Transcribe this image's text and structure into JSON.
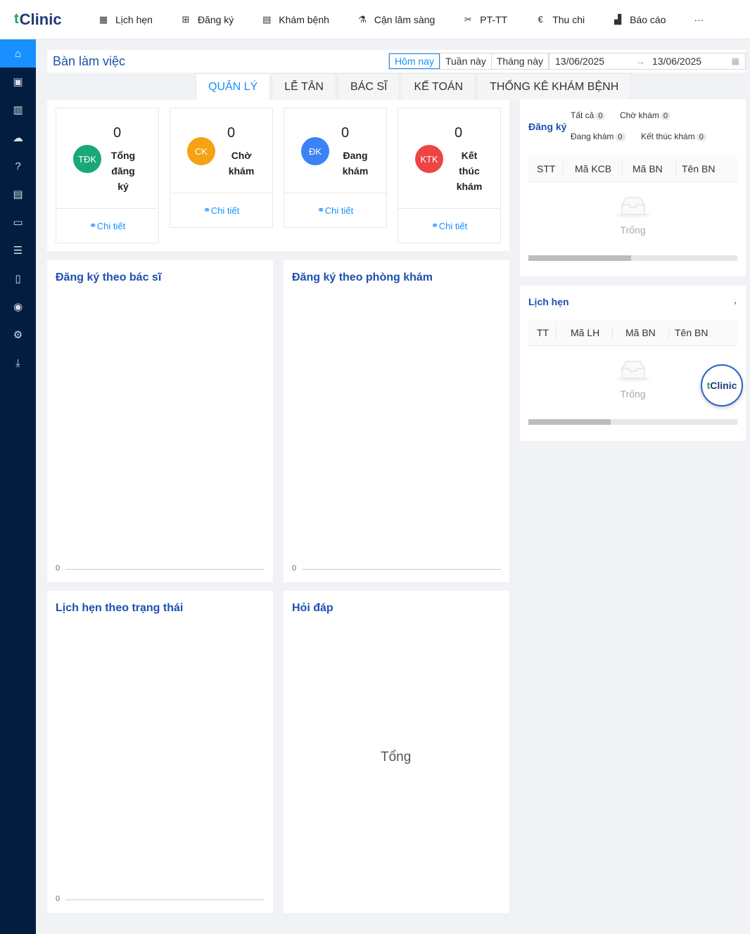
{
  "brand": {
    "name": "Clinic",
    "mark": "t"
  },
  "nav": [
    {
      "label": "Lịch hẹn",
      "icon": "calendar-icon",
      "glyph": "▦"
    },
    {
      "label": "Đăng ký",
      "icon": "plus-square-icon",
      "glyph": "⊞"
    },
    {
      "label": "Khám bệnh",
      "icon": "clipboard-icon",
      "glyph": "▤"
    },
    {
      "label": "Cận lâm sàng",
      "icon": "flask-icon",
      "glyph": "⚗"
    },
    {
      "label": "PT-TT",
      "icon": "scissors-icon",
      "glyph": "✂"
    },
    {
      "label": "Thu chi",
      "icon": "euro-circle-icon",
      "glyph": "€"
    },
    {
      "label": "Báo cáo",
      "icon": "area-chart-icon",
      "glyph": "▟"
    }
  ],
  "nav_more": "···",
  "sidebar": [
    {
      "icon": "home-icon",
      "glyph": "⌂",
      "active": true
    },
    {
      "icon": "id-card-icon",
      "glyph": "▣"
    },
    {
      "icon": "shop-icon",
      "glyph": "▥"
    },
    {
      "icon": "cloud-upload-icon",
      "glyph": "☁"
    },
    {
      "icon": "question-circle-icon",
      "glyph": "?"
    },
    {
      "icon": "profile-icon",
      "glyph": "▤"
    },
    {
      "icon": "money-icon",
      "glyph": "▭"
    },
    {
      "icon": "list-icon",
      "glyph": "☰"
    },
    {
      "icon": "file-text-icon",
      "glyph": "▯"
    },
    {
      "icon": "user-circle-icon",
      "glyph": "◉"
    },
    {
      "icon": "settings-icon",
      "glyph": "⚙"
    },
    {
      "icon": "download-icon",
      "glyph": "⤓"
    }
  ],
  "header": {
    "title": "Bàn làm việc",
    "periods": [
      "Hôm nay",
      "Tuần này",
      "Tháng này"
    ],
    "active_period": "Hôm nay",
    "date_from": "13/06/2025",
    "date_to": "13/06/2025",
    "arrow": "→"
  },
  "tabs": [
    "QUẢN LÝ",
    "LỄ TÂN",
    "BÁC SĨ",
    "KẾ TOÁN",
    "THỐNG KÊ KHÁM BỆNH"
  ],
  "active_tab": "QUẢN LÝ",
  "stats": [
    {
      "abbr": "TĐK",
      "count": "0",
      "label1": "Tổng",
      "label2": "đăng",
      "label3": "ký",
      "color": "#1aa77a",
      "link": "Chi tiết"
    },
    {
      "abbr": "CK",
      "count": "0",
      "label1": "Chờ",
      "label2": "khám",
      "label3": "",
      "color": "#f5a213",
      "link": "Chi tiết"
    },
    {
      "abbr": "ĐK",
      "count": "0",
      "label1": "Đang",
      "label2": "khám",
      "label3": "",
      "color": "#3b82f6",
      "link": "Chi tiết"
    },
    {
      "abbr": "KTK",
      "count": "0",
      "label1": "Kết",
      "label2": "thúc",
      "label3": "khám",
      "color": "#ef4444",
      "link": "Chi tiết"
    }
  ],
  "charts": {
    "by_doctor": {
      "title": "Đăng ký theo bác sĩ",
      "zero": "0"
    },
    "by_room": {
      "title": "Đăng ký theo phòng khám",
      "zero": "0"
    },
    "appt_status": {
      "title": "Lịch hẹn theo trạng thái",
      "zero": "0"
    },
    "faq": {
      "title": "Hỏi đáp",
      "center": "Tổng"
    }
  },
  "registrations": {
    "title": "Đăng ký",
    "filters": [
      {
        "label": "Tất cả",
        "count": "0"
      },
      {
        "label": "Chờ khám",
        "count": "0"
      },
      {
        "label": "Đang khám",
        "count": "0"
      },
      {
        "label": "Kết thúc khám",
        "count": "0"
      }
    ],
    "columns": [
      "STT",
      "Mã KCB",
      "Mã BN",
      "Tên BN"
    ],
    "empty": "Trống"
  },
  "appointments": {
    "title": "Lịch hẹn",
    "comma": ",",
    "columns": [
      "TT",
      "Mã LH",
      "Mã BN",
      "Tên BN"
    ],
    "empty": "Trống"
  },
  "float_logo": {
    "name": "Clinic",
    "mark": "t"
  }
}
